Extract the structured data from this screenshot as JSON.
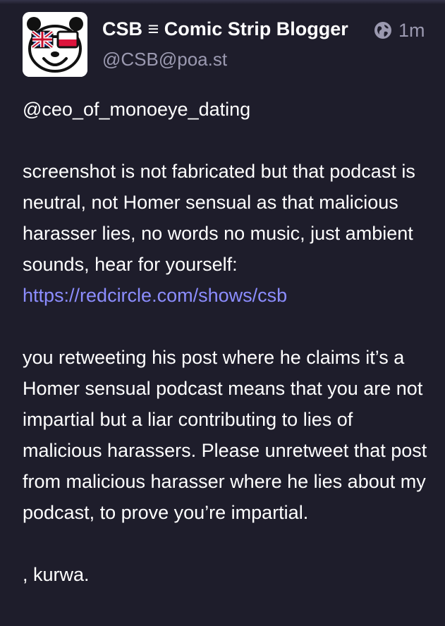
{
  "post": {
    "author": {
      "display_name": "CSB ≡ Comic Strip Blogger",
      "handle": "@CSB@poa.st",
      "avatar_icon": "panda-sunglasses-avatar-icon"
    },
    "visibility_icon": "globe-icon",
    "timestamp": "1m",
    "mention": "@ceo_of_monoeye_dating",
    "paragraph1_text": "screenshot is not fabricated but that podcast is neutral, not Homer sensual as that malicious harasser lies, no words no music, just ambient sounds, hear for yourself: ",
    "paragraph1_link": "https://redcircle.com/shows/csb",
    "paragraph2": "you retweeting his post where he claims it’s a Homer sensual podcast means that you are not impartial but a liar contributing to lies of malicious harassers. Please unretweet that post from malicious harasser where he lies about my podcast, to prove you’re impartial.",
    "paragraph3": ", kurwa."
  },
  "colors": {
    "background": "#1e1d2b",
    "text": "#ffffff",
    "muted": "#9b99b0",
    "link": "#8c8dff"
  }
}
